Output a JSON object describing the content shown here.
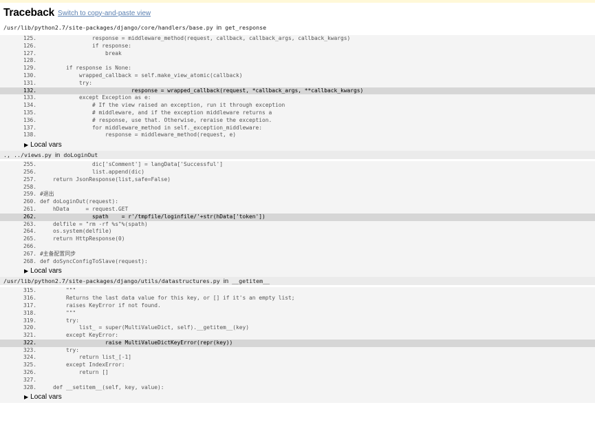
{
  "header": {
    "title": "Traceback",
    "switch_link": "Switch to copy-and-paste view"
  },
  "local_vars_label": "Local vars",
  "frames": [
    {
      "file": "/usr/lib/python2.7/site-packages/django/core/handlers/base.py",
      "in_word": "in",
      "func": "get_response",
      "lines": [
        {
          "no": "125.",
          "code": "                response = middleware_method(request, callback, callback_args, callback_kwargs)"
        },
        {
          "no": "126.",
          "code": "                if response:"
        },
        {
          "no": "127.",
          "code": "                    break"
        },
        {
          "no": "128.",
          "code": ""
        },
        {
          "no": "129.",
          "code": "        if response is None:"
        },
        {
          "no": "130.",
          "code": "            wrapped_callback = self.make_view_atomic(callback)"
        },
        {
          "no": "131.",
          "code": "            try:"
        },
        {
          "no": "132.",
          "code": "                            response = wrapped_callback(request, *callback_args, **callback_kwargs)"
        },
        {
          "no": "133.",
          "code": "            except Exception as e:"
        },
        {
          "no": "134.",
          "code": "                # If the view raised an exception, run it through exception"
        },
        {
          "no": "135.",
          "code": "                # middleware, and if the exception middleware returns a"
        },
        {
          "no": "136.",
          "code": "                # response, use that. Otherwise, reraise the exception."
        },
        {
          "no": "137.",
          "code": "                for middleware_method in self._exception_middleware:"
        },
        {
          "no": "138.",
          "code": "                    response = middleware_method(request, e)"
        }
      ]
    },
    {
      "file": "., ../views.py",
      "in_word": "in",
      "func": "doLoginOut",
      "lines": [
        {
          "no": "255.",
          "code": "                dic['sComment'] = langData['Successful']"
        },
        {
          "no": "256.",
          "code": "                list.append(dic)"
        },
        {
          "no": "257.",
          "code": "    return JsonResponse(list,safe=False)"
        },
        {
          "no": "258.",
          "code": ""
        },
        {
          "no": "259.",
          "code": "#退出"
        },
        {
          "no": "260.",
          "code": "def doLoginOut(request):"
        },
        {
          "no": "261.",
          "code": "    hData     = request.GET"
        },
        {
          "no": "262.",
          "code": "                spath    = r'/tmpfile/loginfile/'+str(hData['token'])"
        },
        {
          "no": "263.",
          "code": "    delfile = \"rm -rf %s\"%(spath)"
        },
        {
          "no": "264.",
          "code": "    os.system(delfile)"
        },
        {
          "no": "265.",
          "code": "    return HttpResponse(0)"
        },
        {
          "no": "266.",
          "code": ""
        },
        {
          "no": "267.",
          "code": "#主备配置同步"
        },
        {
          "no": "268.",
          "code": "def doSyncConfigToSlave(request):"
        }
      ]
    },
    {
      "file": "/usr/lib/python2.7/site-packages/django/utils/datastructures.py",
      "in_word": "in",
      "func": "__getitem__",
      "lines": [
        {
          "no": "315.",
          "code": "        \"\"\""
        },
        {
          "no": "316.",
          "code": "        Returns the last data value for this key, or [] if it's an empty list;"
        },
        {
          "no": "317.",
          "code": "        raises KeyError if not found."
        },
        {
          "no": "318.",
          "code": "        \"\"\""
        },
        {
          "no": "319.",
          "code": "        try:"
        },
        {
          "no": "320.",
          "code": "            list_ = super(MultiValueDict, self).__getitem__(key)"
        },
        {
          "no": "321.",
          "code": "        except KeyError:"
        },
        {
          "no": "322.",
          "code": "                    raise MultiValueDictKeyError(repr(key))"
        },
        {
          "no": "323.",
          "code": "        try:"
        },
        {
          "no": "324.",
          "code": "            return list_[-1]"
        },
        {
          "no": "325.",
          "code": "        except IndexError:"
        },
        {
          "no": "326.",
          "code": "            return []"
        },
        {
          "no": "327.",
          "code": ""
        },
        {
          "no": "328.",
          "code": "    def __setitem__(self, key, value):"
        }
      ]
    }
  ]
}
